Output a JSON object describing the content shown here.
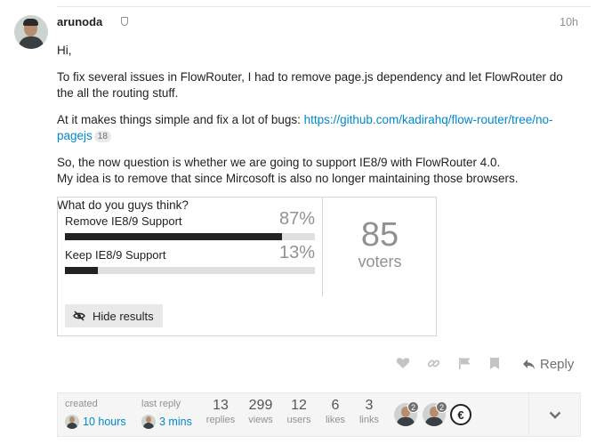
{
  "post": {
    "username": "arunoda",
    "time": "10h",
    "paragraphs": {
      "p1": "Hi,",
      "p2": "To fix several issues in FlowRouter, I had to remove page.js dependency and let FlowRouter do the all the routing stuff.",
      "p3_text": "At it makes things simple and fix a lot of bugs: ",
      "p3_link": "https://github.com/kadirahq/flow-router/tree/no-pagejs",
      "p3_clicks": "18",
      "p4_line1": "So, the now question is whether we are going to support IE8/9 with FlowRouter 4.0.",
      "p4_line2": "My idea is to remove that since Mircosoft is also no longer maintaining those browsers.",
      "p5": "What do you guys think?"
    }
  },
  "poll": {
    "options": [
      {
        "label": "Remove IE8/9 Support",
        "percent_label": "87%",
        "percent": 87
      },
      {
        "label": "Keep IE8/9 Support",
        "percent_label": "13%",
        "percent": 13
      }
    ],
    "voters_count": "85",
    "voters_label": "voters",
    "hide_results_label": "Hide results",
    "icons": {
      "hide": "eye-slash-icon"
    }
  },
  "actions": {
    "icons": [
      "heart-icon",
      "link-icon",
      "flag-icon",
      "bookmark-icon"
    ],
    "reply_label": "Reply"
  },
  "summary": {
    "created_label": "created",
    "created_time": "10 hours",
    "last_reply_label": "last reply",
    "last_reply_time": "3 mins",
    "stats": [
      {
        "num": "13",
        "label": "replies"
      },
      {
        "num": "299",
        "label": "views"
      },
      {
        "num": "12",
        "label": "users"
      },
      {
        "num": "6",
        "label": "likes"
      },
      {
        "num": "3",
        "label": "links"
      }
    ],
    "participants": [
      {
        "count": "2"
      },
      {
        "count": "2"
      },
      {
        "letter": "€"
      }
    ]
  },
  "colors": {
    "link": "#0088cc",
    "muted": "#919191",
    "bar": "#222222",
    "bar_bg": "#e0e0e0"
  }
}
